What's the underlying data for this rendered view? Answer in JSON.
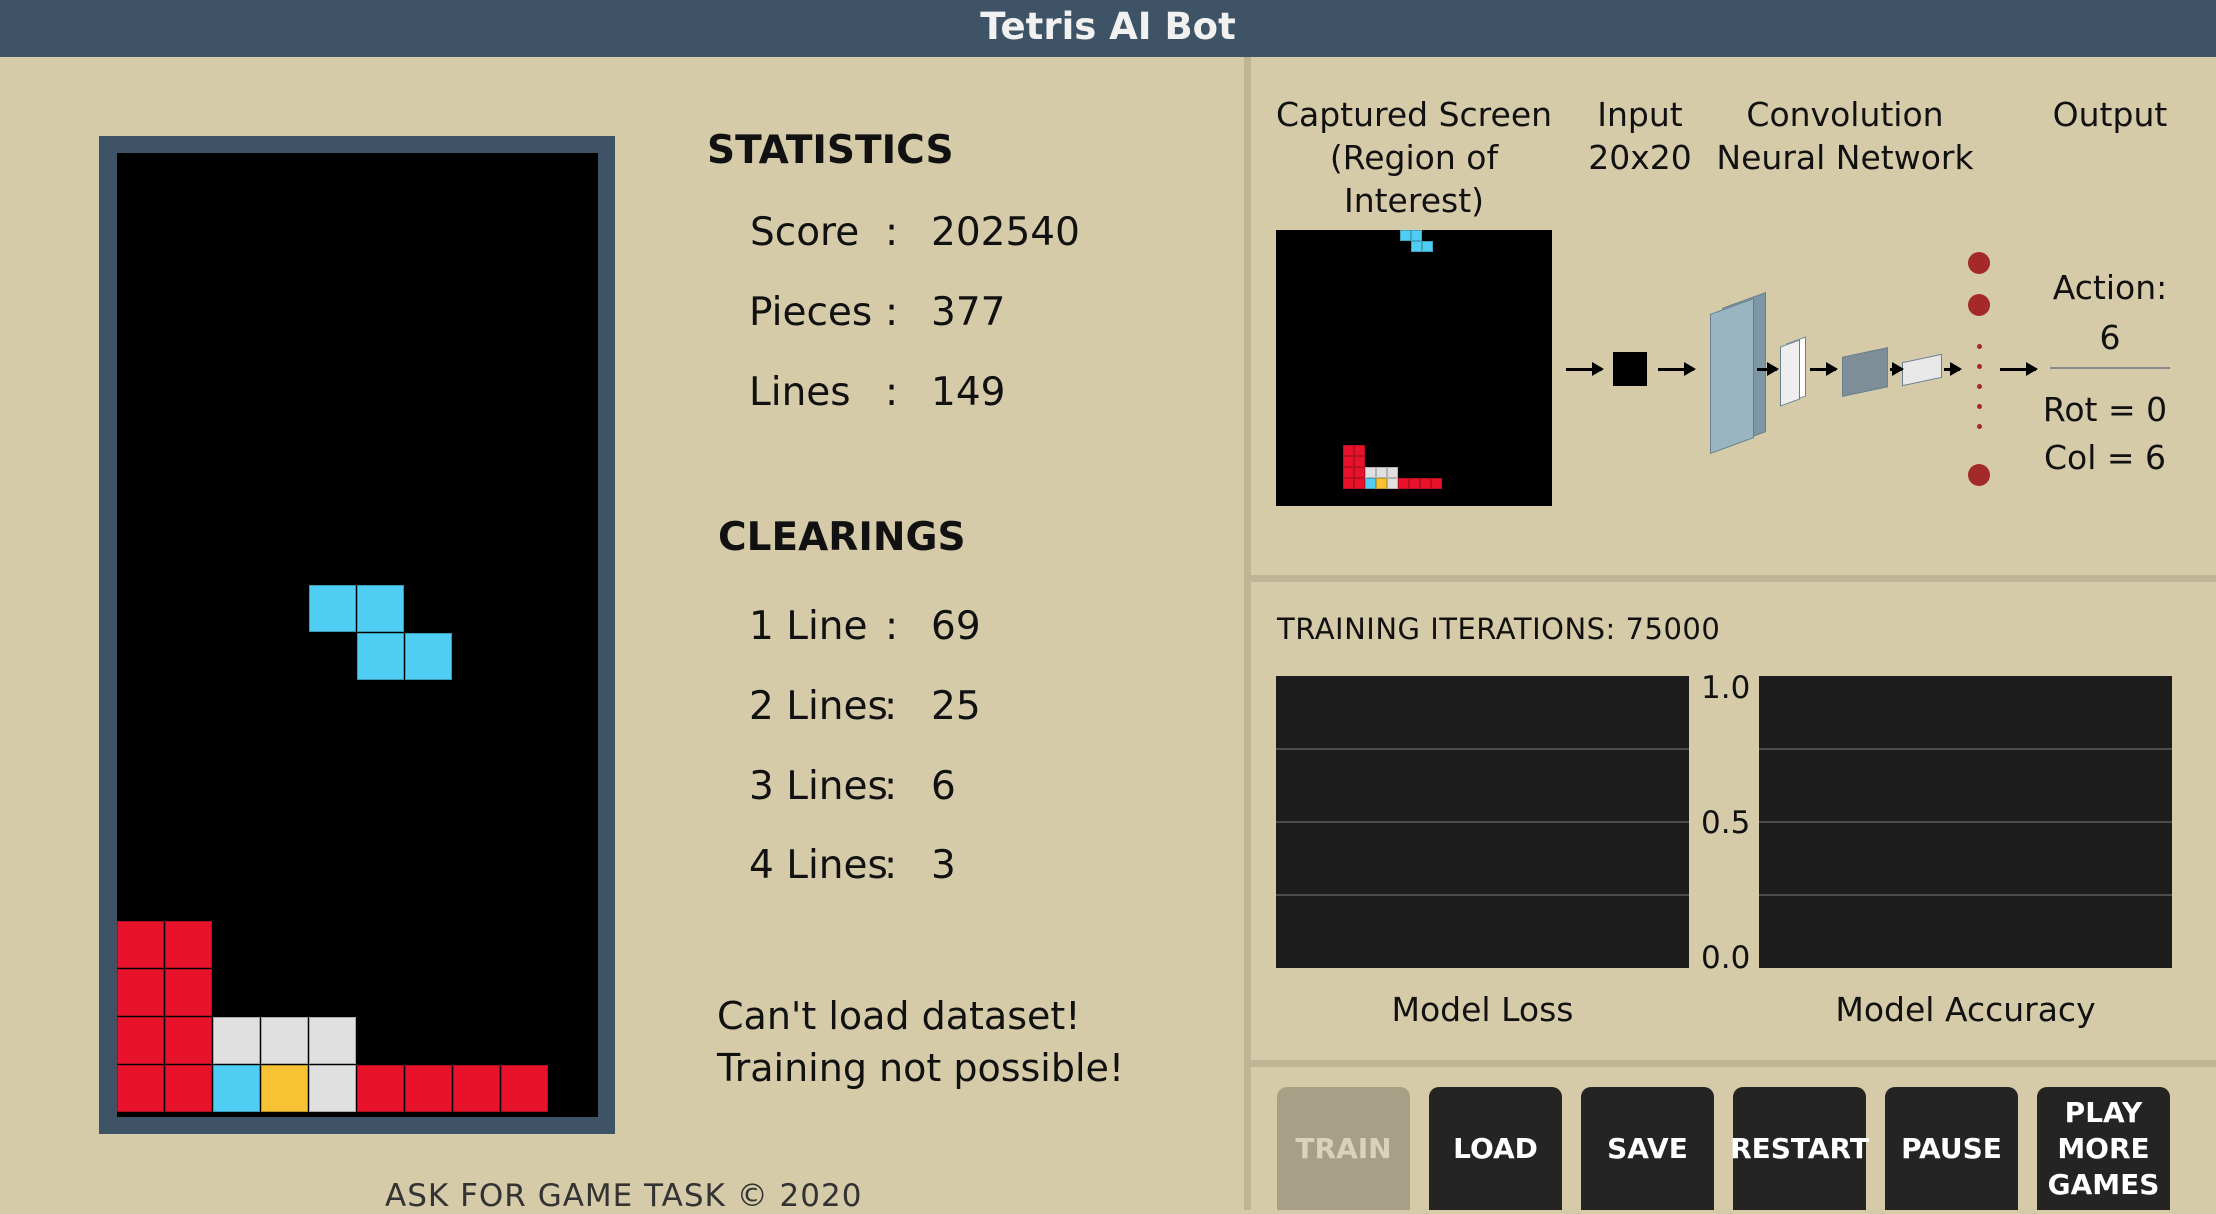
{
  "title": "Tetris AI Bot",
  "statistics": {
    "heading": "STATISTICS",
    "rows": [
      {
        "label": "Score",
        "colon": ":",
        "value": "202540"
      },
      {
        "label": "Pieces",
        "colon": ":",
        "value": "377"
      },
      {
        "label": "Lines",
        "colon": ":",
        "value": "149"
      }
    ]
  },
  "clearings": {
    "heading": "CLEARINGS",
    "rows": [
      {
        "label": "1 Line",
        "colon": ":",
        "value": "69"
      },
      {
        "label": "2 Lines",
        "colon": ":",
        "value": "25"
      },
      {
        "label": "3 Lines",
        "colon": ":",
        "value": "6"
      },
      {
        "label": "4 Lines",
        "colon": ":",
        "value": "3"
      }
    ]
  },
  "message": {
    "line1": "Can't load dataset!",
    "line2": "Training not possible!"
  },
  "footer": "ASK FOR GAME TASK © 2020",
  "network": {
    "captured_line1": "Captured Screen",
    "captured_line2": "(Region of Interest)",
    "input_line1": "Input",
    "input_line2": "20x20",
    "cnn_line1": "Convolution",
    "cnn_line2": "Neural Network",
    "output_label": "Output",
    "action_label": "Action:",
    "action_value": "6",
    "rot": "Rot = 0",
    "col": "Col = 6"
  },
  "training": {
    "iterations_label": "TRAINING ITERATIONS: 75000",
    "ticks": [
      "1.0",
      "0.5",
      "0.0"
    ],
    "loss_label": "Model Loss",
    "accuracy_label": "Model Accuracy"
  },
  "buttons": [
    {
      "label": "TRAIN",
      "enabled": false
    },
    {
      "label": "LOAD",
      "enabled": true
    },
    {
      "label": "SAVE",
      "enabled": true
    },
    {
      "label": "RESTART",
      "enabled": true
    },
    {
      "label": "PAUSE",
      "enabled": true
    },
    {
      "label": "PLAY\nMORE\nGAMES",
      "enabled": true
    }
  ],
  "colors": {
    "red": "#e8132a",
    "cyan": "#4fcdf2",
    "white": "#e0e0e0",
    "yellow": "#f7c234"
  },
  "board": {
    "cols": 10,
    "rows": 20,
    "active_piece": {
      "type": "Z",
      "color": "cyan",
      "cells": [
        [
          4,
          9
        ],
        [
          5,
          9
        ],
        [
          5,
          10
        ],
        [
          6,
          10
        ]
      ]
    },
    "locked": [
      {
        "c": 0,
        "r": 16,
        "color": "red"
      },
      {
        "c": 1,
        "r": 16,
        "color": "red"
      },
      {
        "c": 0,
        "r": 17,
        "color": "red"
      },
      {
        "c": 1,
        "r": 17,
        "color": "red"
      },
      {
        "c": 0,
        "r": 18,
        "color": "red"
      },
      {
        "c": 1,
        "r": 18,
        "color": "red"
      },
      {
        "c": 2,
        "r": 18,
        "color": "white"
      },
      {
        "c": 3,
        "r": 18,
        "color": "white"
      },
      {
        "c": 4,
        "r": 18,
        "color": "white"
      },
      {
        "c": 0,
        "r": 19,
        "color": "red"
      },
      {
        "c": 1,
        "r": 19,
        "color": "red"
      },
      {
        "c": 2,
        "r": 19,
        "color": "cyan"
      },
      {
        "c": 3,
        "r": 19,
        "color": "yellow"
      },
      {
        "c": 4,
        "r": 19,
        "color": "white"
      },
      {
        "c": 5,
        "r": 19,
        "color": "red"
      },
      {
        "c": 6,
        "r": 19,
        "color": "red"
      },
      {
        "c": 7,
        "r": 19,
        "color": "red"
      },
      {
        "c": 8,
        "r": 19,
        "color": "red"
      }
    ]
  }
}
